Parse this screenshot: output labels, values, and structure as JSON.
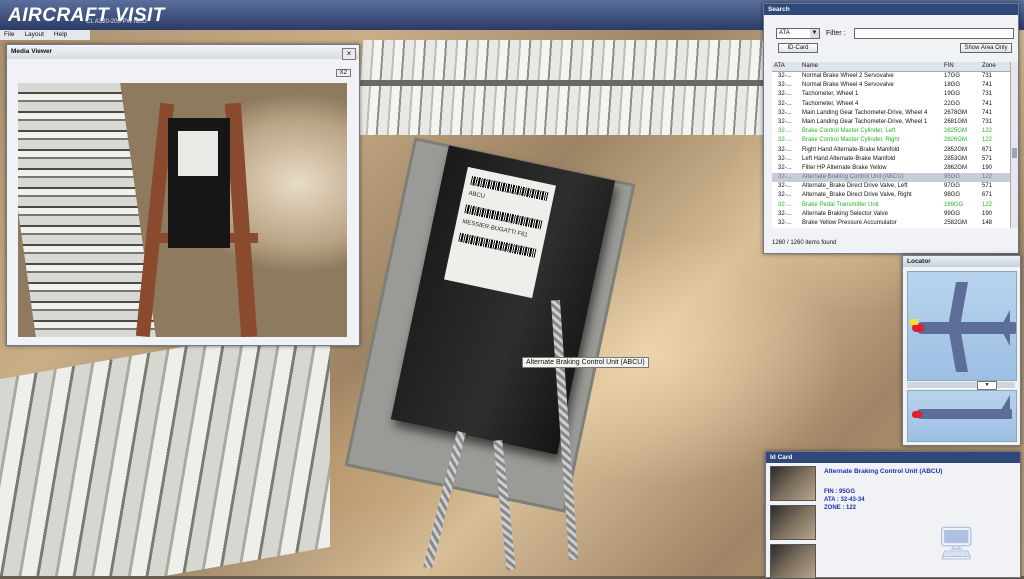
{
  "app": {
    "title": "AIRCRAFT VISIT",
    "subtitle": "CL A320-200 PW NEO"
  },
  "menu": [
    "File",
    "Layout",
    "Help"
  ],
  "scene": {
    "tooltip": "Alternate Braking Control Unit (ABCU)",
    "box_label": "ABCU",
    "box_brand": "MESSIER-BUGATTI F61"
  },
  "media_viewer": {
    "title": "Media Viewer",
    "close": "×",
    "zoom_button": "X2"
  },
  "search": {
    "title": "Search",
    "type_select": "ATA",
    "filter_label": "Filter :",
    "filter_value": "",
    "id_card_button": "ID-Card",
    "show_area_button": "Show Area Only",
    "columns": {
      "ata": "ATA",
      "name": "Name",
      "fin": "FIN",
      "zone": "Zone"
    },
    "rows": [
      {
        "ata": "32-...",
        "name": "Normal Brake Wheel 2 Servovalve",
        "fin": "17GG",
        "zone": "731",
        "style": ""
      },
      {
        "ata": "32-...",
        "name": "Normal Brake Wheel 4 Servovalve",
        "fin": "18GG",
        "zone": "741",
        "style": ""
      },
      {
        "ata": "32-...",
        "name": "Tachometer, Wheel 1",
        "fin": "19GG",
        "zone": "731",
        "style": ""
      },
      {
        "ata": "32-...",
        "name": "Tachometer, Wheel 4",
        "fin": "22GG",
        "zone": "741",
        "style": ""
      },
      {
        "ata": "32-...",
        "name": "Main Landing Gear Tachometer-Drive, Wheel 4",
        "fin": "2678GM",
        "zone": "741",
        "style": ""
      },
      {
        "ata": "32-...",
        "name": "Main Landing Gear Tachometer-Drive, Wheel 1",
        "fin": "2681GM",
        "zone": "731",
        "style": ""
      },
      {
        "ata": "32-...",
        "name": "Brake Control Master Cylinder, Left",
        "fin": "2825GM",
        "zone": "122",
        "style": "green"
      },
      {
        "ata": "32-...",
        "name": "Brake Control Master Cylinder, Right",
        "fin": "2826GM",
        "zone": "122",
        "style": "green"
      },
      {
        "ata": "32-...",
        "name": "Right Hand Alternate-Brake Manifold",
        "fin": "2852GM",
        "zone": "671",
        "style": ""
      },
      {
        "ata": "32-...",
        "name": "Left Hand Alternate-Brake Manifold",
        "fin": "2853GM",
        "zone": "571",
        "style": ""
      },
      {
        "ata": "32-...",
        "name": "Filter HP Alternate Brake Yellow",
        "fin": "2862GM",
        "zone": "190",
        "style": ""
      },
      {
        "ata": "32-...",
        "name": "Alternate Braking Control Unit (ABCU)",
        "fin": "95GG",
        "zone": "122",
        "style": "selected"
      },
      {
        "ata": "32-...",
        "name": "Alternate_Brake Direct Drive Valve, Left",
        "fin": "97GG",
        "zone": "571",
        "style": ""
      },
      {
        "ata": "32-...",
        "name": "Alternate_Brake Direct Drive Valve, Right",
        "fin": "98GG",
        "zone": "671",
        "style": ""
      },
      {
        "ata": "32-...",
        "name": "Brake Pedal Transmitter Unit",
        "fin": "169GG",
        "zone": "122",
        "style": "green"
      },
      {
        "ata": "32-...",
        "name": "Alternate Braking Selector Valve",
        "fin": "99GG",
        "zone": "190",
        "style": ""
      },
      {
        "ata": "32-...",
        "name": "Brake Yellow Pressure Accumulator",
        "fin": "2582GM",
        "zone": "148",
        "style": ""
      }
    ],
    "count_text": "1260 / 1260 items found"
  },
  "locator": {
    "title": "Locator"
  },
  "id_card": {
    "title": "Id Card",
    "name": "Alternate Braking Control Unit (ABCU)",
    "fin": "FIN : 95GG",
    "ata": "ATA : 32-43-34",
    "zone": "ZONE : 122"
  },
  "colors": {
    "header": "#2f4779",
    "highlight_green": "#27b427",
    "idcard_text": "#1c2fb4"
  }
}
